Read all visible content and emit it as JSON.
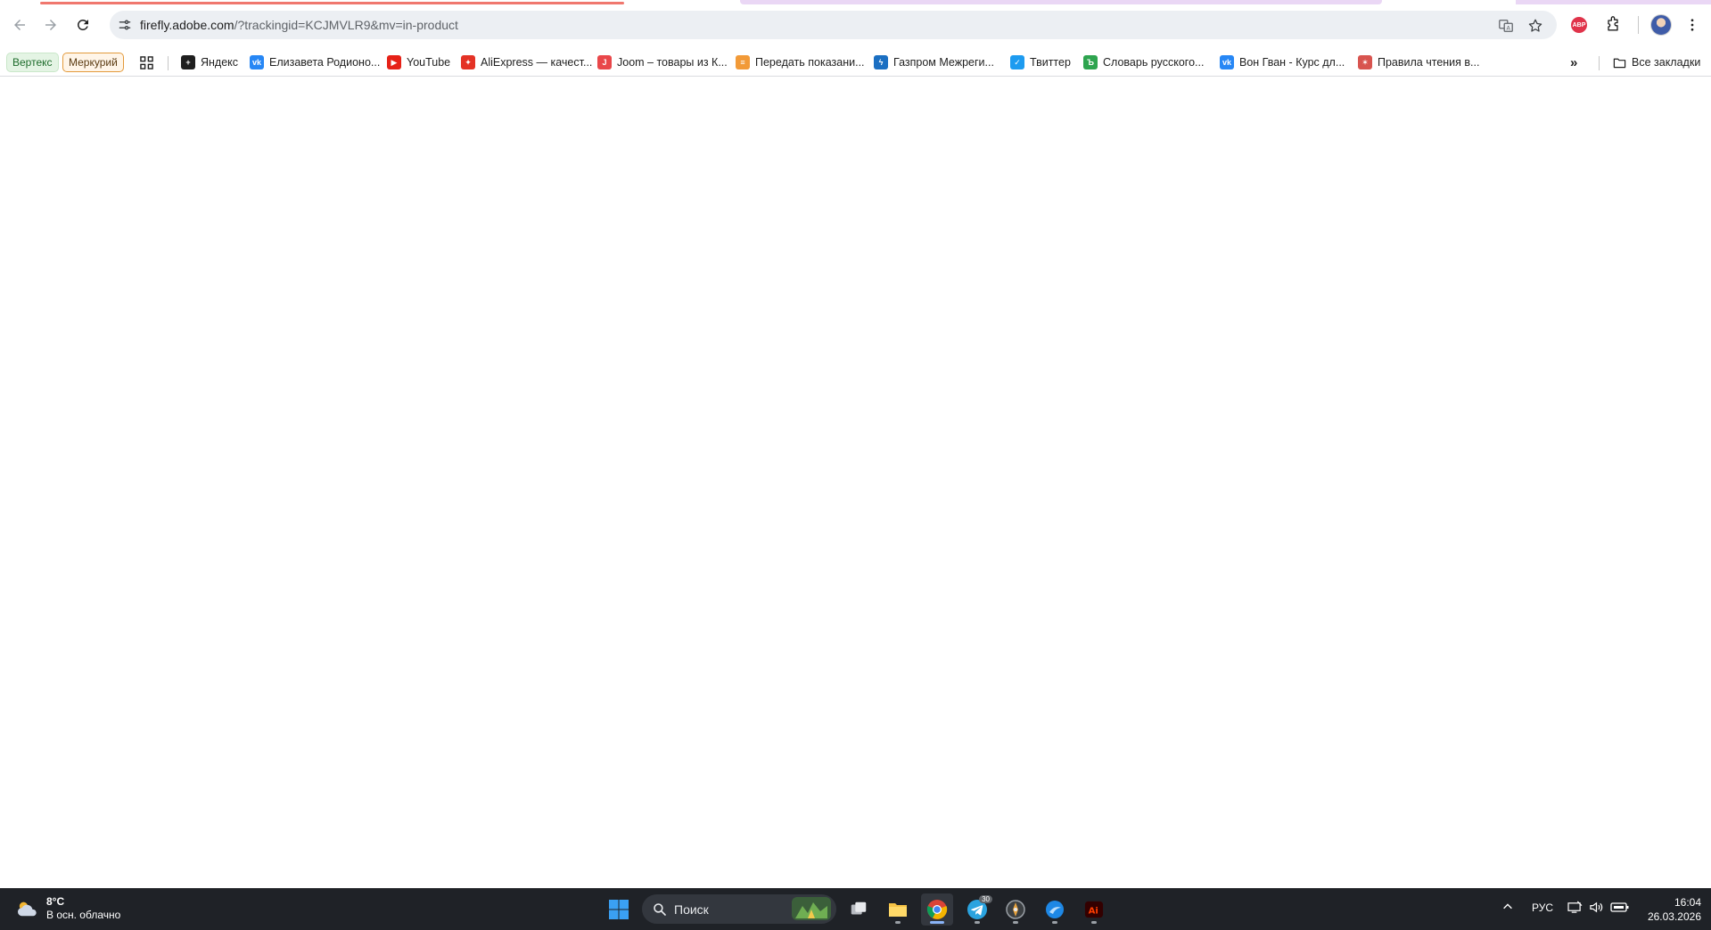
{
  "browser": {
    "url_host": "firefly.adobe.com",
    "url_rest": "/?trackingid=KCJMVLR9&mv=in-product",
    "load_progress": 0.42,
    "all_bookmarks_label": "Все закладки",
    "overflow_label": "»"
  },
  "bookmarks": {
    "chips": [
      {
        "label": "Вертекс"
      },
      {
        "label": "Меркурий"
      }
    ],
    "items": [
      {
        "label": "Яндекс",
        "icon": "yandex-icon",
        "color": "#1f1f1f"
      },
      {
        "label": "Елизавета Родионо...",
        "icon": "vk-icon",
        "color": "#2787f5"
      },
      {
        "label": "YouTube",
        "icon": "youtube-icon",
        "color": "#e62117"
      },
      {
        "label": "AliExpress — качест...",
        "icon": "aliexpress-icon",
        "color": "#e43225"
      },
      {
        "label": "Joom – товары из К...",
        "icon": "joom-icon",
        "color": "#e9474a"
      },
      {
        "label": "Передать показани...",
        "icon": "meter-icon",
        "color": "#f29a38"
      },
      {
        "label": "Газпром Межреги...",
        "icon": "gazprom-icon",
        "color": "#1b6fc2"
      },
      {
        "label": "Твиттер",
        "icon": "twitter-icon",
        "color": "#1d9bf0"
      },
      {
        "label": "Словарь русского...",
        "icon": "dictionary-icon",
        "color": "#2ea44f"
      },
      {
        "label": "Вон Гван - Курс дл...",
        "icon": "vk-icon",
        "color": "#2787f5"
      },
      {
        "label": "Правила чтения в...",
        "icon": "star-burst-icon",
        "color": "#d8544f"
      }
    ]
  },
  "taskbar": {
    "weather_temp": "8°C",
    "weather_desc": "В осн. облачно",
    "search_label": "Поиск",
    "language": "РУС",
    "time": "16:04",
    "date": "26.03.2026",
    "telegram_badge": "30",
    "colors": {
      "background": "#1f2227",
      "accent": "#8ab4f8"
    }
  }
}
